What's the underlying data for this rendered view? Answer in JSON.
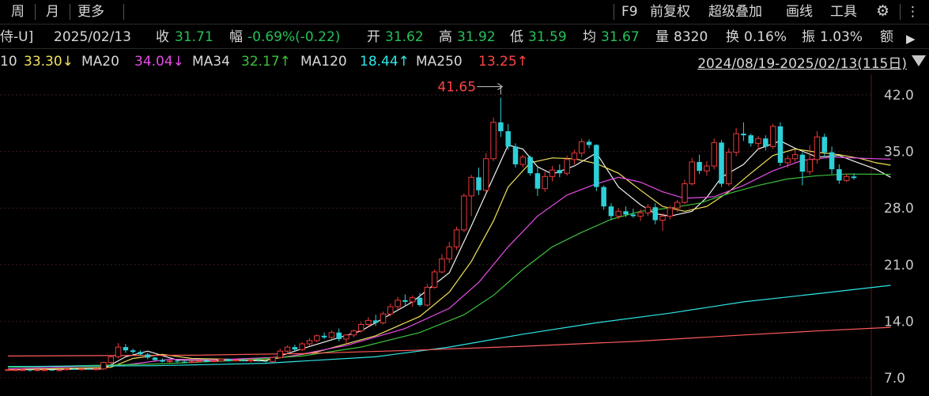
{
  "toolbar": {
    "left_tabs": [
      "周",
      "月",
      "更多"
    ],
    "right_items": [
      "F9",
      "前复权",
      "超级叠加",
      "画线",
      "工具"
    ]
  },
  "info": {
    "name_fragment": "侍-U]",
    "date": "2025/02/13",
    "close_label": "收",
    "close": "31.71",
    "change_label": "幅",
    "change": "-0.69%(-0.22)",
    "open_label": "开",
    "open": "31.62",
    "high_label": "高",
    "high": "31.92",
    "low_label": "低",
    "low": "31.59",
    "avg_label": "均",
    "avg": "31.67",
    "volume_label": "量",
    "volume": "8320",
    "turnover_label": "换",
    "turnover": "0.16%",
    "amplitude_label": "振",
    "amplitude": "1.03%",
    "amount_label": "额"
  },
  "ma": {
    "ma10_label": "10",
    "ma10": "33.30↓",
    "ma20_label": "MA20",
    "ma20": "34.04↓",
    "ma34_label": "MA34",
    "ma34": "32.17↑",
    "ma120_label": "MA120",
    "ma120": "18.44↑",
    "ma250_label": "MA250",
    "ma250": "13.25↑",
    "range": "2024/08/19-2025/02/13(115日)"
  },
  "colors": {
    "up": "#e8393a",
    "down": "#2ed0d8",
    "ma5": "#f2f2f2",
    "ma10": "#f2e25c",
    "ma20": "#e64ce6",
    "ma34": "#3cc03c",
    "ma120": "#2ee6e6",
    "ma250": "#ff5a5a"
  },
  "chart_data": {
    "type": "candlestick",
    "ylim": [
      7.0,
      42.0
    ],
    "yticks": [
      "42.0",
      "35.0",
      "28.0",
      "21.0",
      "14.0",
      "7.0"
    ],
    "max_label": "41.65",
    "grid": true,
    "candles": [
      [
        8.0,
        8.1,
        7.9,
        8.0
      ],
      [
        8.0,
        8.0,
        7.9,
        8.0
      ],
      [
        8.0,
        8.1,
        7.9,
        8.0
      ],
      [
        8.0,
        8.0,
        7.8,
        7.9
      ],
      [
        7.9,
        8.0,
        7.8,
        8.0
      ],
      [
        8.0,
        8.1,
        7.9,
        8.0
      ],
      [
        8.0,
        8.0,
        7.9,
        7.9
      ],
      [
        7.9,
        8.0,
        7.8,
        8.0
      ],
      [
        8.0,
        8.1,
        7.9,
        8.1
      ],
      [
        8.1,
        8.2,
        8.0,
        8.0
      ],
      [
        8.0,
        8.1,
        7.9,
        8.1
      ],
      [
        8.1,
        8.2,
        8.0,
        8.0
      ],
      [
        8.0,
        8.1,
        7.9,
        8.1
      ],
      [
        8.1,
        9.0,
        8.0,
        8.9
      ],
      [
        8.9,
        9.8,
        8.7,
        9.6
      ],
      [
        9.6,
        11.3,
        9.4,
        10.8
      ],
      [
        10.8,
        11.2,
        10.1,
        10.4
      ],
      [
        10.4,
        10.6,
        10.0,
        10.2
      ],
      [
        10.2,
        10.4,
        9.8,
        9.9
      ],
      [
        9.9,
        10.1,
        9.3,
        9.5
      ],
      [
        9.5,
        9.6,
        9.1,
        9.2
      ],
      [
        9.2,
        9.4,
        8.9,
        9.0
      ],
      [
        9.0,
        9.2,
        8.8,
        9.1
      ],
      [
        9.1,
        9.3,
        8.9,
        9.0
      ],
      [
        9.0,
        9.1,
        8.8,
        8.9
      ],
      [
        8.9,
        9.1,
        8.8,
        9.0
      ],
      [
        9.0,
        9.2,
        8.9,
        9.1
      ],
      [
        9.1,
        9.3,
        8.9,
        9.0
      ],
      [
        9.0,
        9.2,
        8.9,
        9.1
      ],
      [
        9.1,
        9.4,
        9.0,
        9.3
      ],
      [
        9.3,
        9.4,
        9.0,
        9.1
      ],
      [
        9.1,
        9.3,
        9.0,
        9.2
      ],
      [
        9.2,
        9.4,
        9.0,
        9.1
      ],
      [
        9.1,
        9.3,
        8.9,
        9.2
      ],
      [
        9.2,
        9.4,
        9.0,
        9.1
      ],
      [
        9.1,
        9.3,
        8.9,
        9.0
      ],
      [
        9.0,
        9.6,
        8.9,
        9.5
      ],
      [
        9.5,
        10.6,
        9.4,
        10.3
      ],
      [
        10.3,
        11.0,
        10.0,
        10.8
      ],
      [
        10.8,
        11.1,
        10.3,
        10.5
      ],
      [
        10.5,
        11.4,
        10.3,
        11.2
      ],
      [
        11.2,
        11.9,
        10.9,
        11.6
      ],
      [
        11.6,
        12.4,
        11.4,
        12.2
      ],
      [
        12.2,
        12.6,
        11.8,
        12.0
      ],
      [
        12.0,
        12.9,
        11.8,
        12.6
      ],
      [
        12.6,
        13.1,
        11.5,
        11.8
      ],
      [
        11.8,
        12.4,
        11.2,
        12.3
      ],
      [
        12.3,
        13.0,
        12.0,
        12.8
      ],
      [
        12.8,
        13.9,
        12.6,
        13.6
      ],
      [
        13.6,
        14.5,
        13.3,
        14.1
      ],
      [
        14.1,
        14.8,
        13.4,
        13.8
      ],
      [
        13.8,
        15.2,
        13.6,
        14.9
      ],
      [
        14.9,
        16.2,
        14.6,
        15.8
      ],
      [
        15.8,
        17.0,
        15.4,
        16.6
      ],
      [
        16.6,
        17.3,
        16.0,
        16.4
      ],
      [
        16.4,
        17.2,
        15.8,
        16.9
      ],
      [
        16.9,
        17.5,
        15.8,
        16.0
      ],
      [
        16.0,
        18.6,
        15.8,
        18.2
      ],
      [
        18.2,
        20.4,
        18.0,
        20.1
      ],
      [
        20.1,
        22.3,
        19.9,
        21.7
      ],
      [
        21.7,
        23.8,
        21.2,
        23.2
      ],
      [
        23.2,
        25.7,
        22.8,
        25.3
      ],
      [
        25.3,
        29.8,
        25.0,
        29.5
      ],
      [
        29.5,
        32.1,
        27.0,
        31.8
      ],
      [
        31.8,
        33.0,
        29.6,
        30.2
      ],
      [
        30.2,
        34.8,
        30.0,
        34.1
      ],
      [
        34.1,
        39.2,
        33.8,
        38.6
      ],
      [
        38.6,
        41.65,
        36.8,
        37.5
      ],
      [
        37.5,
        38.4,
        35.2,
        35.6
      ],
      [
        35.6,
        36.0,
        33.0,
        33.4
      ],
      [
        33.4,
        34.6,
        33.0,
        34.3
      ],
      [
        34.3,
        34.5,
        32.0,
        32.3
      ],
      [
        32.3,
        33.0,
        29.5,
        30.4
      ],
      [
        30.4,
        32.5,
        30.0,
        31.9
      ],
      [
        31.9,
        33.2,
        31.3,
        32.7
      ],
      [
        32.7,
        33.4,
        31.8,
        32.3
      ],
      [
        32.3,
        34.5,
        32.0,
        34.0
      ],
      [
        34.0,
        35.2,
        33.4,
        34.8
      ],
      [
        34.8,
        36.6,
        34.3,
        36.2
      ],
      [
        36.2,
        36.5,
        35.4,
        35.8
      ],
      [
        35.8,
        35.9,
        30.1,
        30.6
      ],
      [
        30.6,
        30.8,
        27.8,
        28.2
      ],
      [
        28.2,
        28.6,
        26.5,
        27.0
      ],
      [
        27.0,
        28.0,
        26.6,
        27.6
      ],
      [
        27.6,
        28.2,
        26.9,
        27.2
      ],
      [
        27.2,
        27.9,
        26.8,
        27.0
      ],
      [
        27.0,
        27.8,
        26.4,
        27.4
      ],
      [
        27.4,
        28.5,
        27.0,
        28.1
      ],
      [
        28.1,
        28.6,
        26.0,
        26.5
      ],
      [
        26.5,
        27.4,
        25.2,
        27.0
      ],
      [
        27.0,
        28.3,
        26.6,
        28.0
      ],
      [
        28.0,
        29.0,
        27.5,
        28.7
      ],
      [
        28.7,
        31.5,
        28.5,
        31.0
      ],
      [
        31.0,
        34.2,
        30.8,
        33.7
      ],
      [
        33.7,
        34.6,
        32.2,
        32.6
      ],
      [
        32.6,
        33.8,
        32.0,
        33.2
      ],
      [
        33.2,
        36.6,
        32.8,
        36.1
      ],
      [
        36.1,
        36.4,
        30.6,
        31.0
      ],
      [
        31.0,
        35.4,
        30.7,
        34.9
      ],
      [
        34.9,
        37.9,
        34.4,
        37.2
      ],
      [
        37.2,
        38.6,
        36.3,
        37.0
      ],
      [
        37.0,
        37.2,
        35.6,
        36.0
      ],
      [
        36.0,
        36.9,
        35.2,
        36.6
      ],
      [
        36.6,
        37.0,
        35.1,
        35.6
      ],
      [
        35.6,
        38.4,
        35.3,
        38.1
      ],
      [
        38.1,
        38.6,
        33.2,
        33.6
      ],
      [
        33.6,
        34.5,
        33.0,
        34.1
      ],
      [
        34.1,
        35.2,
        33.7,
        34.6
      ],
      [
        34.6,
        34.9,
        30.8,
        32.5
      ],
      [
        32.5,
        35.8,
        32.1,
        34.0
      ],
      [
        34.0,
        37.5,
        33.5,
        36.8
      ],
      [
        36.8,
        37.2,
        34.3,
        34.9
      ],
      [
        34.9,
        35.6,
        32.2,
        32.8
      ],
      [
        32.8,
        33.4,
        31.0,
        31.4
      ],
      [
        31.4,
        32.2,
        31.2,
        31.9
      ],
      [
        31.9,
        32.3,
        31.5,
        31.71
      ]
    ],
    "moving_averages": [
      {
        "name": "MA5",
        "points": [
          [
            0,
            8.0
          ],
          [
            13,
            8.1
          ],
          [
            16,
            9.6
          ],
          [
            19,
            10.3
          ],
          [
            23,
            9.2
          ],
          [
            35,
            9.1
          ],
          [
            40,
            10.6
          ],
          [
            48,
            12.8
          ],
          [
            55,
            16.4
          ],
          [
            60,
            20.0
          ],
          [
            63,
            25.8
          ],
          [
            66,
            31.8
          ],
          [
            68,
            35.8
          ],
          [
            70,
            35.3
          ],
          [
            72,
            33.1
          ],
          [
            74,
            32.2
          ],
          [
            77,
            33.2
          ],
          [
            80,
            34.8
          ],
          [
            83,
            30.6
          ],
          [
            86,
            28.4
          ],
          [
            88,
            27.3
          ],
          [
            90,
            27.0
          ],
          [
            93,
            27.6
          ],
          [
            95,
            29.3
          ],
          [
            97,
            31.8
          ],
          [
            100,
            33.4
          ],
          [
            102,
            35.3
          ],
          [
            105,
            36.3
          ],
          [
            107,
            35.4
          ],
          [
            110,
            34.3
          ],
          [
            113,
            34.5
          ],
          [
            115,
            33.8
          ],
          [
            118,
            32.8
          ],
          [
            120,
            31.8
          ]
        ]
      },
      {
        "name": "MA10",
        "points": [
          [
            0,
            8.0
          ],
          [
            14,
            8.3
          ],
          [
            17,
            9.4
          ],
          [
            21,
            9.9
          ],
          [
            25,
            9.4
          ],
          [
            35,
            9.2
          ],
          [
            42,
            10.2
          ],
          [
            50,
            12.2
          ],
          [
            56,
            14.6
          ],
          [
            60,
            17.6
          ],
          [
            63,
            21.4
          ],
          [
            66,
            26.4
          ],
          [
            68,
            30.6
          ],
          [
            71,
            33.6
          ],
          [
            74,
            34.2
          ],
          [
            77,
            34.1
          ],
          [
            80,
            33.5
          ],
          [
            83,
            32.3
          ],
          [
            86,
            30.2
          ],
          [
            89,
            28.2
          ],
          [
            92,
            27.6
          ],
          [
            95,
            28.2
          ],
          [
            98,
            30.0
          ],
          [
            101,
            32.3
          ],
          [
            104,
            34.5
          ],
          [
            107,
            35.3
          ],
          [
            110,
            34.9
          ],
          [
            113,
            34.6
          ],
          [
            116,
            34.1
          ],
          [
            118,
            33.6
          ],
          [
            120,
            33.3
          ]
        ]
      },
      {
        "name": "MA20",
        "points": [
          [
            0,
            8.1
          ],
          [
            16,
            8.6
          ],
          [
            22,
            9.3
          ],
          [
            28,
            9.2
          ],
          [
            38,
            9.6
          ],
          [
            46,
            11.0
          ],
          [
            54,
            13.1
          ],
          [
            60,
            15.6
          ],
          [
            64,
            18.8
          ],
          [
            68,
            23.2
          ],
          [
            72,
            27.0
          ],
          [
            76,
            29.6
          ],
          [
            80,
            31.0
          ],
          [
            83,
            31.8
          ],
          [
            86,
            31.2
          ],
          [
            89,
            30.0
          ],
          [
            92,
            29.2
          ],
          [
            96,
            29.4
          ],
          [
            100,
            30.8
          ],
          [
            104,
            32.6
          ],
          [
            108,
            33.9
          ],
          [
            112,
            34.3
          ],
          [
            115,
            34.2
          ],
          [
            118,
            34.1
          ],
          [
            120,
            34.04
          ]
        ]
      },
      {
        "name": "MA34",
        "points": [
          [
            0,
            8.3
          ],
          [
            20,
            8.7
          ],
          [
            30,
            9.1
          ],
          [
            40,
            9.7
          ],
          [
            48,
            10.8
          ],
          [
            56,
            12.6
          ],
          [
            62,
            14.8
          ],
          [
            66,
            17.2
          ],
          [
            70,
            20.4
          ],
          [
            74,
            23.2
          ],
          [
            78,
            25.0
          ],
          [
            82,
            26.6
          ],
          [
            86,
            27.6
          ],
          [
            90,
            28.0
          ],
          [
            94,
            28.6
          ],
          [
            98,
            29.8
          ],
          [
            102,
            30.8
          ],
          [
            106,
            31.6
          ],
          [
            110,
            32.0
          ],
          [
            114,
            32.2
          ],
          [
            120,
            32.17
          ]
        ]
      },
      {
        "name": "MA120",
        "points": [
          [
            0,
            8.4
          ],
          [
            20,
            8.5
          ],
          [
            35,
            8.8
          ],
          [
            50,
            9.6
          ],
          [
            60,
            10.8
          ],
          [
            70,
            12.4
          ],
          [
            80,
            13.8
          ],
          [
            90,
            15.0
          ],
          [
            100,
            16.4
          ],
          [
            110,
            17.4
          ],
          [
            120,
            18.44
          ]
        ]
      },
      {
        "name": "MA250",
        "points": [
          [
            0,
            9.7
          ],
          [
            25,
            9.8
          ],
          [
            40,
            10.0
          ],
          [
            55,
            10.4
          ],
          [
            70,
            10.9
          ],
          [
            85,
            11.5
          ],
          [
            100,
            12.3
          ],
          [
            110,
            12.8
          ],
          [
            120,
            13.25
          ]
        ]
      }
    ]
  }
}
